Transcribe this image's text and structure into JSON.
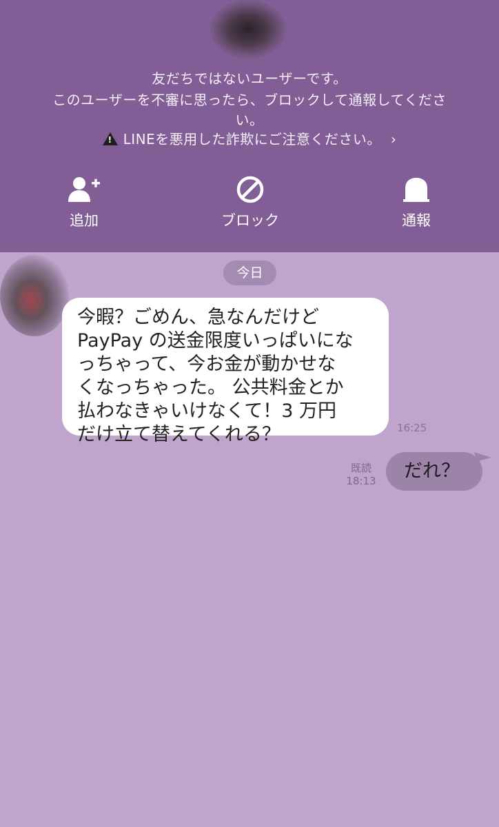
{
  "colors": {
    "header_bg": "#815e95",
    "chat_bg": "#bfa5cc",
    "incoming_bubble": "#ffffff",
    "outgoing_bubble": "#9c84a9",
    "date_pill": "#a48bb2"
  },
  "warning": {
    "line1": "友だちではないユーザーです。",
    "line2": "このユーザーを不審に思ったら、ブロックして通報してくださ",
    "line3": "い。",
    "scam_notice": "LINEを悪用した詐欺にご注意ください。",
    "scam_icon": "warning-triangle-icon",
    "chevron": "›"
  },
  "actions": {
    "add": {
      "label": "追加",
      "icon": "add-friend-icon"
    },
    "block": {
      "label": "ブロック",
      "icon": "block-icon"
    },
    "report": {
      "label": "通報",
      "icon": "report-icon"
    }
  },
  "chat": {
    "date_label": "今日",
    "messages": [
      {
        "direction": "incoming",
        "lines": [
          "今暇？ごめん、急なんだけど",
          "PayPay の送金限度いっぱいにな",
          "っちゃって、今お金が動かせな",
          "くなっちゃった。 公共料金とか",
          "払わなきゃいけなくて！3 万円",
          "だけ立て替えてくれる？"
        ],
        "time": "16:25"
      },
      {
        "direction": "outgoing",
        "text": "だれ？",
        "read_label": "既読",
        "time": "18:13"
      }
    ]
  }
}
